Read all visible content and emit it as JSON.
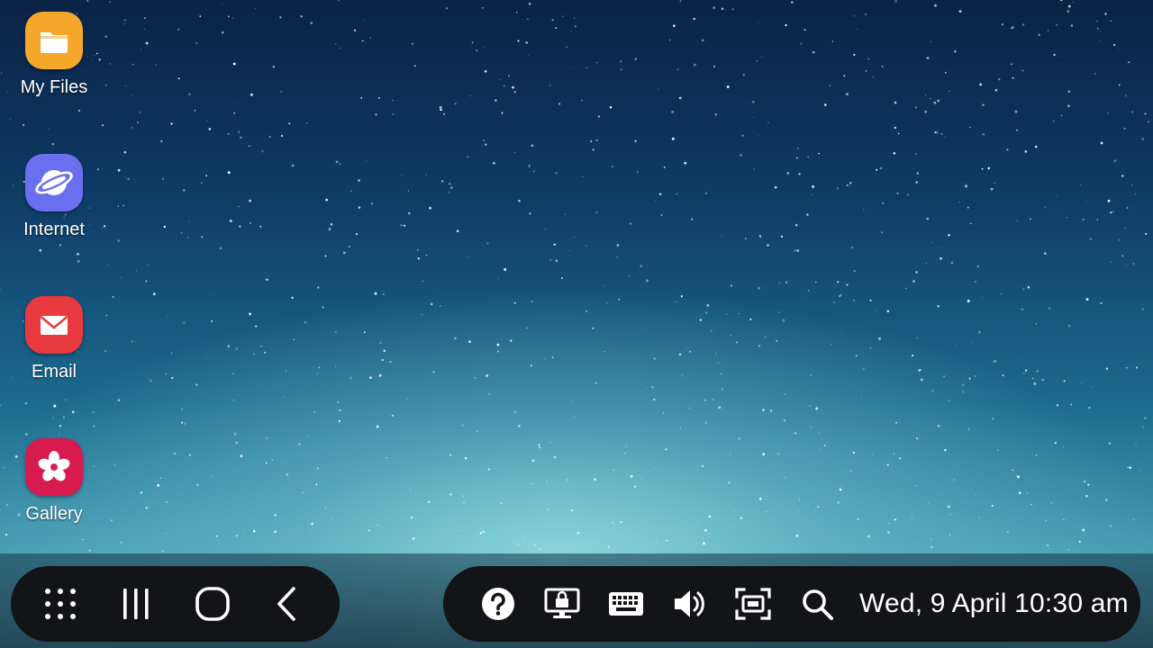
{
  "desktop": {
    "icons": [
      {
        "label": "My Files",
        "icon": "folder-icon",
        "color": "#f3a82b"
      },
      {
        "label": "Internet",
        "icon": "globe-icon",
        "color": "#6a6ff0"
      },
      {
        "label": "Email",
        "icon": "envelope-icon",
        "color": "#e8393f"
      },
      {
        "label": "Gallery",
        "icon": "flower-icon",
        "color": "#d81b4f"
      }
    ]
  },
  "taskbar": {
    "nav": {
      "apps": {
        "icon": "apps-grid-icon"
      },
      "recents": {
        "icon": "recents-icon"
      },
      "home": {
        "icon": "home-icon"
      },
      "back": {
        "icon": "back-icon"
      }
    },
    "tray": {
      "help": {
        "icon": "help-icon"
      },
      "screen_lock": {
        "icon": "screen-lock-icon"
      },
      "keyboard": {
        "icon": "keyboard-icon"
      },
      "volume": {
        "icon": "volume-icon"
      },
      "screenshot": {
        "icon": "screen-capture-icon"
      },
      "search": {
        "icon": "search-icon"
      },
      "clock": "Wed, 9 April 10:30 am"
    }
  }
}
